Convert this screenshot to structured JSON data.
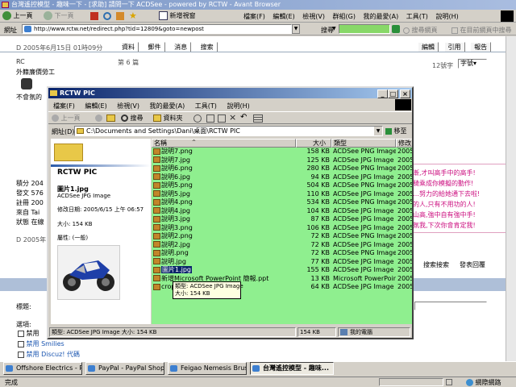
{
  "browser": {
    "title": "台灣遙控模型 - 趣味一下 - [求助] 請問一下 ACDSee - powered by RCTW - Avant Browser",
    "toolbar": {
      "back": "上一頁",
      "forward": "下一頁",
      "new_window": "新增視窗"
    },
    "menu": [
      "檔案(F)",
      "編輯(E)",
      "檢視(V)",
      "群組(G)",
      "我的最愛(A)",
      "工具(T)",
      "說明(H)"
    ],
    "address_label": "網址",
    "address": "http://www.rctw.net/redirect.php?tid=12809&goto=newpost",
    "search_label": "搜尋",
    "search_web": "搜尋網頁",
    "search_page": "在目前網頁中搜尋",
    "status": "完成",
    "status_zone": "網際網路"
  },
  "forum": {
    "top_links": [
      "資料",
      "郵件",
      "消息",
      "搜索"
    ],
    "reply_buttons": [
      "編輯",
      "引用",
      "報告"
    ],
    "post_date": "D 2005年6月15日 01時09分",
    "floor": "第 6 篇",
    "font_size_label": "12號字",
    "font_select": "字號",
    "user_name": "RC",
    "user_title": "外籍廉價勞工",
    "snippet": "不會氛的",
    "stats": [
      "積分 204",
      "發文 576",
      "註冊 200",
      "來自 Tai",
      "狀態 在線"
    ],
    "red_text": [
      "漸,才叫高手中的高手!",
      "騎乘成你模擬的動作!",
      "…努力的給她通下去啦!",
      "的人,只有不用功的人!",
      "山高,強中自有強中手!",
      "氛我,下次你會肯定我!"
    ],
    "bottom_links": [
      "搜索接索",
      "發表回覆"
    ],
    "date2": "D 2005年",
    "subject_label": "標題:",
    "options_label": "選項:",
    "opt1": "禁用",
    "opt2": "禁用 Smilies",
    "opt3": "禁用 Discuz! 代碼"
  },
  "explorer": {
    "title": "RCTW PIC",
    "menu": [
      "檔案(F)",
      "編輯(E)",
      "檢視(V)",
      "我的最愛(A)",
      "工具(T)",
      "說明(H)"
    ],
    "toolbar": {
      "back": "上一頁",
      "search": "搜尋",
      "folders": "資料夾"
    },
    "address_label": "網址(D)",
    "address": "C:\\Documents and Settings\\Dani\\桌面\\RCTW PIC",
    "go_label": "移至",
    "folder_name": "RCTW PIC",
    "selected_name": "圖片1.jpg",
    "selected_type": "ACDSee JPG Image",
    "modified": "修改日期: 2005/6/15 上午 06:57",
    "size": "大小: 154 KB",
    "attributes": "屬性: (一般)",
    "columns": [
      "名稱",
      "大小",
      "類型",
      "修改日"
    ],
    "files": [
      {
        "name": "說明7.png",
        "size": "158 KB",
        "type": "ACDSee PNG Image",
        "date": "2005/6."
      },
      {
        "name": "說明7.jpg",
        "size": "125 KB",
        "type": "ACDSee JPG Image",
        "date": "2005/6."
      },
      {
        "name": "說明6.png",
        "size": "280 KB",
        "type": "ACDSee PNG Image",
        "date": "2005/6."
      },
      {
        "name": "說明6.jpg",
        "size": "94 KB",
        "type": "ACDSee JPG Image",
        "date": "2005/6."
      },
      {
        "name": "說明5.png",
        "size": "504 KB",
        "type": "ACDSee PNG Image",
        "date": "2005/6."
      },
      {
        "name": "說明5.jpg",
        "size": "110 KB",
        "type": "ACDSee JPG Image",
        "date": "2005/6."
      },
      {
        "name": "說明4.png",
        "size": "534 KB",
        "type": "ACDSee PNG Image",
        "date": "2005/6."
      },
      {
        "name": "說明4.jpg",
        "size": "104 KB",
        "type": "ACDSee JPG Image",
        "date": "2005/6."
      },
      {
        "name": "說明3.jpg",
        "size": "87 KB",
        "type": "ACDSee JPG Image",
        "date": "2005/6."
      },
      {
        "name": "說明3.png",
        "size": "106 KB",
        "type": "ACDSee JPG Image",
        "date": "2005/6."
      },
      {
        "name": "說明2.png",
        "size": "72 KB",
        "type": "ACDSee PNG Image",
        "date": "2005/6."
      },
      {
        "name": "說明2.jpg",
        "size": "72 KB",
        "type": "ACDSee JPG Image",
        "date": "2005/6."
      },
      {
        "name": "說明.png",
        "size": "72 KB",
        "type": "ACDSee PNG Image",
        "date": "2005/6."
      },
      {
        "name": "說明.jpg",
        "size": "77 KB",
        "type": "ACDSee JPG Image",
        "date": "2005/6."
      },
      {
        "name": "圖片1.jpg",
        "size": "155 KB",
        "type": "ACDSee JPG Image",
        "date": "2005/6."
      },
      {
        "name": "新增Microsoft PowerPoint 簡報.ppt",
        "size": "13 KB",
        "type": "Microsoft PowerPoin...",
        "date": "2005/6."
      },
      {
        "name": "crop",
        "size": "64 KB",
        "type": "ACDSee JPG Image",
        "date": "2005/6."
      }
    ],
    "tooltip_type": "類型: ACDSee JPG Image",
    "tooltip_size": "大小: 154 KB",
    "status_left": "類型: ACDSee JPG Image 大小: 154 KB",
    "status_mid": "154 KB",
    "status_right": "我的電腦"
  },
  "taskbar": [
    "Offshore Electrics - R/c b...",
    "PayPal - PayPal Shopping...",
    "Feigao Nemesis Brushles...",
    "台灣遙控模型 - 趣味..."
  ]
}
